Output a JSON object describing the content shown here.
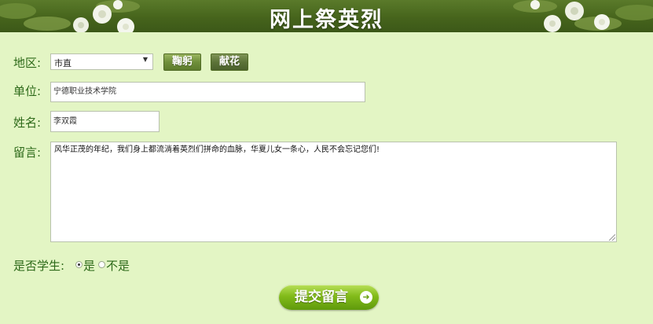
{
  "header": {
    "title": "网上祭英烈"
  },
  "form": {
    "region_label": "地区:",
    "region_value": "市直",
    "bow_button": "鞠躬",
    "flower_button": "献花",
    "unit_label": "单位:",
    "unit_value": "宁德职业技术学院",
    "name_label": "姓名:",
    "name_value": "李双霞",
    "message_label": "留言:",
    "message_value": "风华正茂的年纪，我们身上都流淌着英烈们拼命的血脉，华夏儿女一条心，人民不会忘记您们!",
    "student_label": "是否学生:",
    "student_yes": "是",
    "student_no": "不是",
    "student_selected": "是",
    "submit_label": "提交留言"
  },
  "icons": [
    "chevron-down-icon",
    "arrow-right-icon",
    "flower-decoration-icon"
  ],
  "colors": {
    "background": "#e3f5c4",
    "banner": "#46641c",
    "accent": "#82bb1a"
  }
}
